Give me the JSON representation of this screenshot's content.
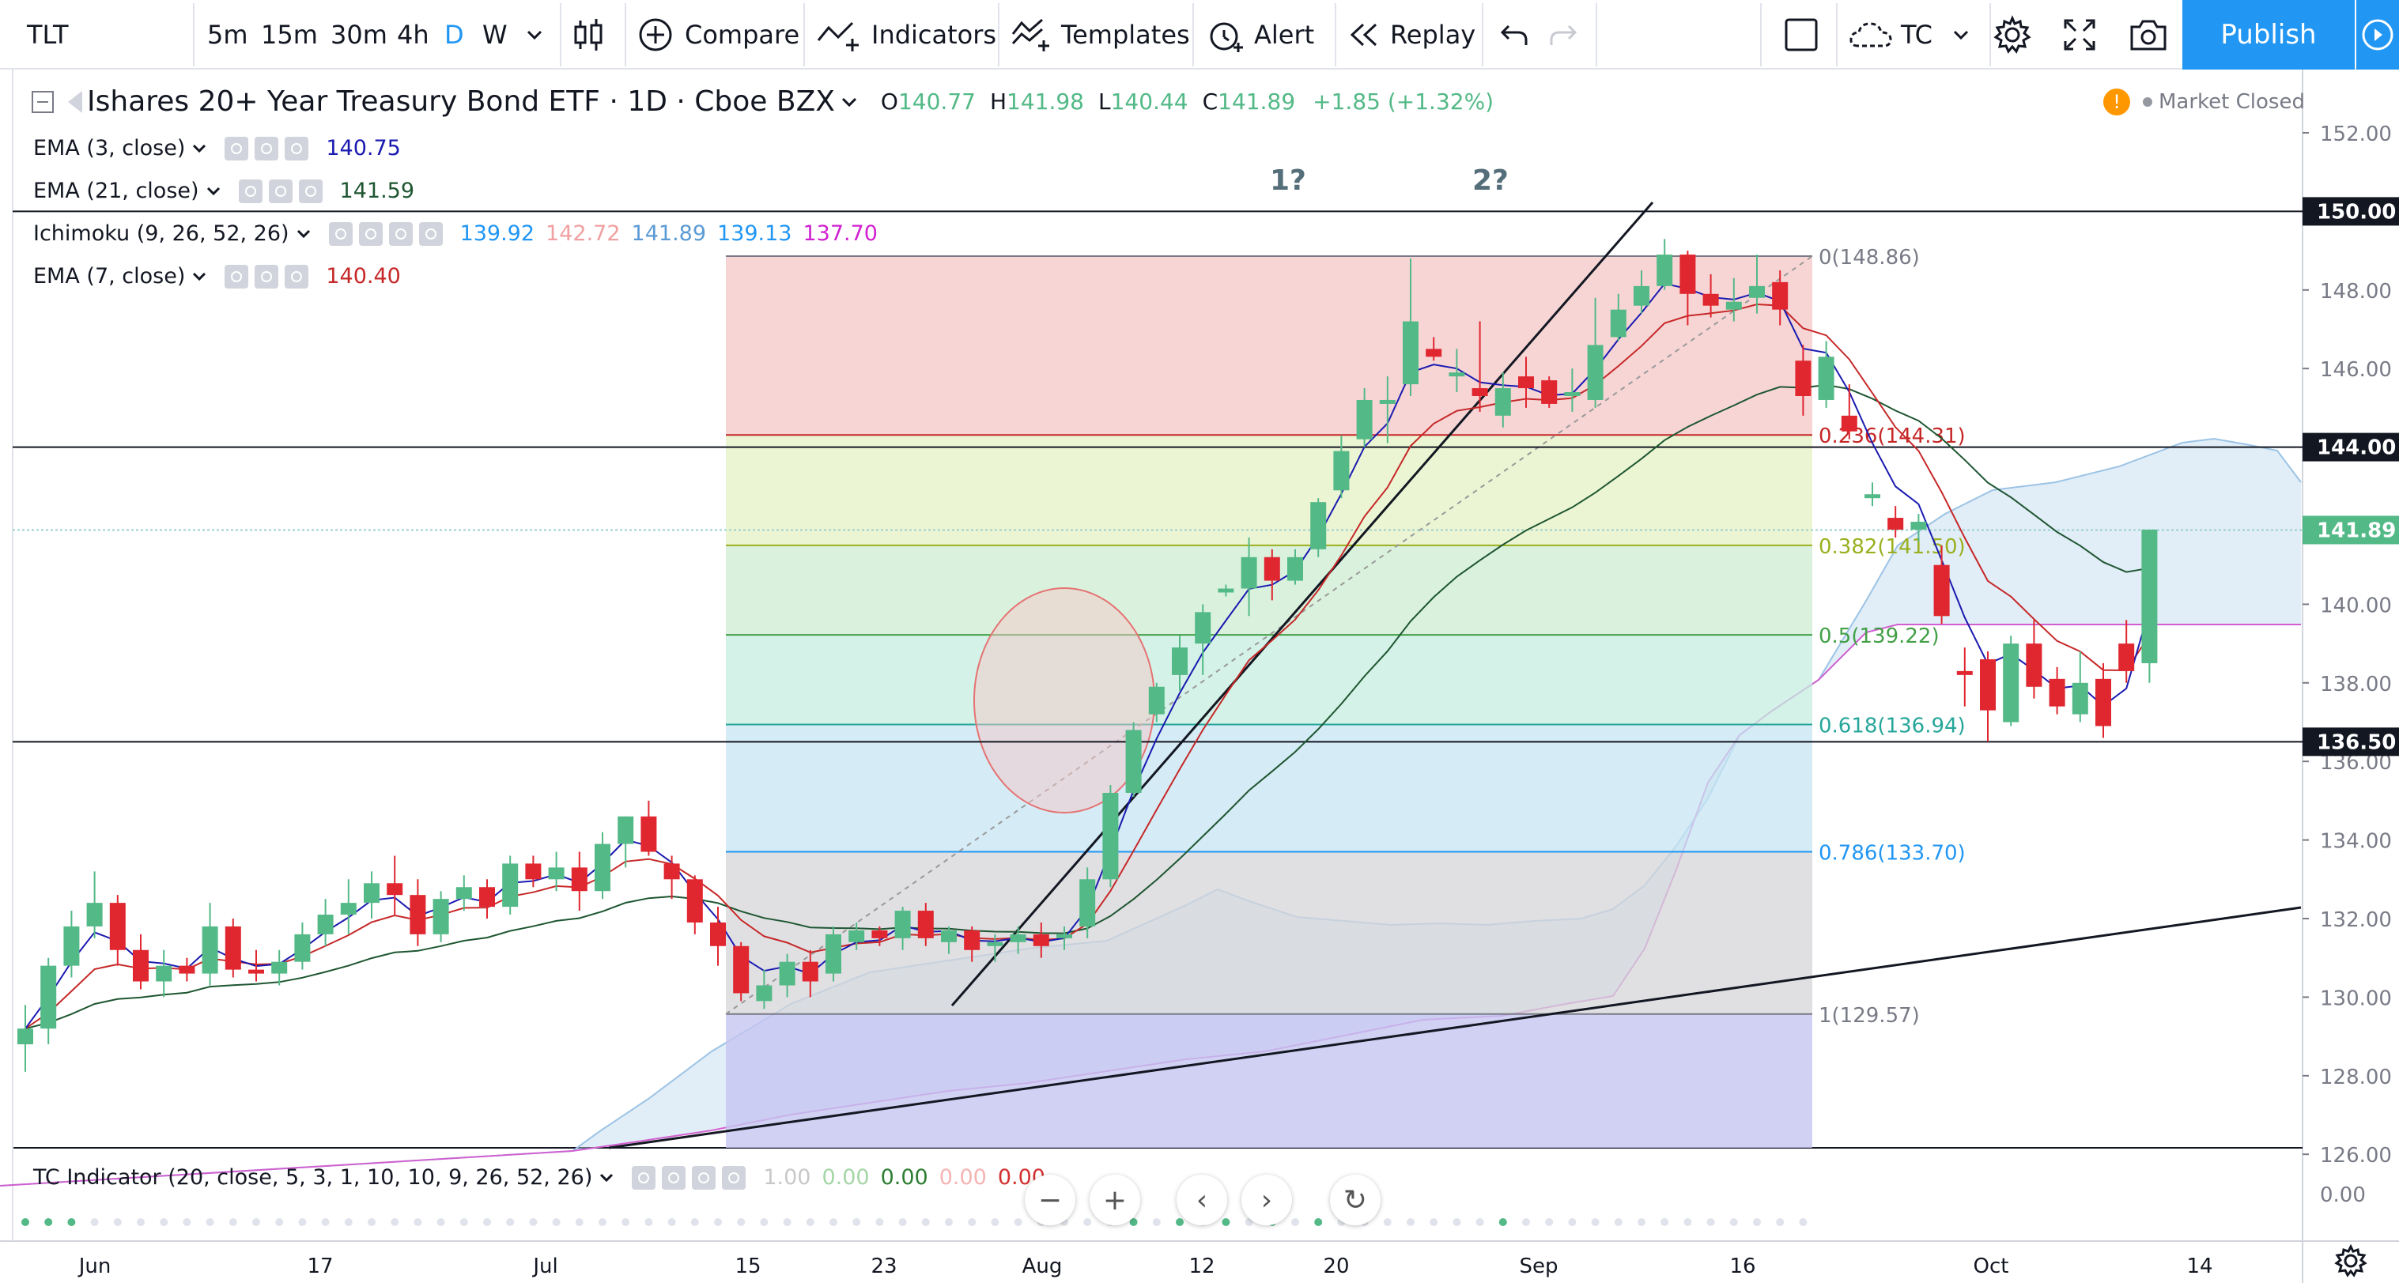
{
  "toolbar": {
    "symbol": "TLT",
    "intervals": [
      "5m",
      "15m",
      "30m",
      "4h",
      "D",
      "W"
    ],
    "active_interval": "D",
    "compare_label": "Compare",
    "indicators_label": "Indicators",
    "templates_label": "Templates",
    "alert_label": "Alert",
    "replay_label": "Replay",
    "layout_name": "TC",
    "publish_label": "Publish"
  },
  "header": {
    "title": "Ishares 20+ Year Treasury Bond ETF · 1D · Cboe BZX",
    "ohlc": {
      "o_label": "O",
      "o": "140.77",
      "h_label": "H",
      "h": "141.98",
      "l_label": "L",
      "l": "140.44",
      "c_label": "C",
      "c": "141.89",
      "change": "+1.85 (+1.32%)"
    },
    "market_status": "Market Closed"
  },
  "legend": [
    {
      "name": "EMA (3, close)",
      "values": [
        {
          "text": "140.75",
          "color": "#1a1ab0"
        }
      ]
    },
    {
      "name": "EMA (21, close)",
      "values": [
        {
          "text": "141.59",
          "color": "#1e5631"
        }
      ]
    },
    {
      "name": "Ichimoku (9, 26, 52, 26)",
      "values": [
        {
          "text": "139.92",
          "color": "#2196f3"
        },
        {
          "text": "142.72",
          "color": "#f0a0a0"
        },
        {
          "text": "141.89",
          "color": "#5b9bd5"
        },
        {
          "text": "139.13",
          "color": "#2196f3"
        },
        {
          "text": "137.70",
          "color": "#d020d0"
        }
      ]
    },
    {
      "name": "EMA (7, close)",
      "values": [
        {
          "text": "140.40",
          "color": "#c62828"
        }
      ]
    }
  ],
  "tc_indicator": {
    "name": "TC Indicator (20, close, 5, 3, 1, 10, 10, 9, 26, 52, 26)",
    "values": [
      {
        "text": "1.00",
        "color": "#c8c8c8"
      },
      {
        "text": "0.00",
        "color": "#a5d6a7"
      },
      {
        "text": "0.00",
        "color": "#2e7d32"
      },
      {
        "text": "0.00",
        "color": "#f4b4b4"
      },
      {
        "text": "0.00",
        "color": "#d32f2f"
      }
    ]
  },
  "annotations": {
    "label_1": "1?",
    "label_2": "2?"
  },
  "price_axis": {
    "ticks": [
      "152.00",
      "150.00",
      "148.00",
      "146.00",
      "144.00",
      "142.00",
      "140.00",
      "138.00",
      "136.00",
      "134.00",
      "132.00",
      "130.00",
      "128.00",
      "126.00"
    ],
    "highlighted": [
      "150.00",
      "144.00",
      "136.50"
    ],
    "current_price": "141.89",
    "oscillator_tick": "0.00"
  },
  "time_axis": [
    "Jun",
    "17",
    "Jul",
    "15",
    "23",
    "Aug",
    "12",
    "20",
    "Sep",
    "16",
    "Oct",
    "14"
  ],
  "fib_levels": [
    {
      "label": "0(148.86)",
      "color": "#787b86",
      "price": 148.86
    },
    {
      "label": "0.236(144.31)",
      "color": "#c62828",
      "price": 144.31
    },
    {
      "label": "0.382(141.50)",
      "color": "#9bb01f",
      "price": 141.5
    },
    {
      "label": "0.5(139.22)",
      "color": "#43a047",
      "price": 139.22
    },
    {
      "label": "0.618(136.94)",
      "color": "#26a69a",
      "price": 136.94
    },
    {
      "label": "0.786(133.70)",
      "color": "#2196f3",
      "price": 133.7
    },
    {
      "label": "1(129.57)",
      "color": "#787b86",
      "price": 129.57
    }
  ],
  "colors": {
    "up": "#53b987",
    "down": "#e0262f",
    "accent": "#2196f3"
  },
  "chart_data": {
    "type": "candlestick",
    "symbol": "TLT",
    "candles_ohlc": [
      [
        128.8,
        129.8,
        128.1,
        129.2
      ],
      [
        129.2,
        131.0,
        128.8,
        130.8
      ],
      [
        130.8,
        132.2,
        130.5,
        131.8
      ],
      [
        131.8,
        133.2,
        131.5,
        132.4
      ],
      [
        132.4,
        132.6,
        130.8,
        131.2
      ],
      [
        131.2,
        131.6,
        130.2,
        130.4
      ],
      [
        130.4,
        131.2,
        130.0,
        130.8
      ],
      [
        130.8,
        131.0,
        130.4,
        130.6
      ],
      [
        130.6,
        132.4,
        130.3,
        131.8
      ],
      [
        131.8,
        132.0,
        130.5,
        130.7
      ],
      [
        130.7,
        131.2,
        130.4,
        130.6
      ],
      [
        130.6,
        131.2,
        130.3,
        130.9
      ],
      [
        130.9,
        131.9,
        130.7,
        131.6
      ],
      [
        131.6,
        132.5,
        131.3,
        132.1
      ],
      [
        132.1,
        133.0,
        131.6,
        132.4
      ],
      [
        132.4,
        133.2,
        132.0,
        132.9
      ],
      [
        132.9,
        133.6,
        132.1,
        132.6
      ],
      [
        132.6,
        133.0,
        131.3,
        131.6
      ],
      [
        131.6,
        132.7,
        131.4,
        132.5
      ],
      [
        132.5,
        133.1,
        132.2,
        132.8
      ],
      [
        132.8,
        133.0,
        132.0,
        132.3
      ],
      [
        132.3,
        133.6,
        132.1,
        133.4
      ],
      [
        133.4,
        133.6,
        132.8,
        133.0
      ],
      [
        133.0,
        133.7,
        132.7,
        133.3
      ],
      [
        133.3,
        133.7,
        132.2,
        132.7
      ],
      [
        132.7,
        134.2,
        132.5,
        133.9
      ],
      [
        133.9,
        134.6,
        133.3,
        134.6
      ],
      [
        134.6,
        135.0,
        133.6,
        133.7
      ],
      [
        133.4,
        133.6,
        132.5,
        133.0
      ],
      [
        133.0,
        133.1,
        131.6,
        131.9
      ],
      [
        131.9,
        132.3,
        130.8,
        131.3
      ],
      [
        131.3,
        131.4,
        129.9,
        130.1
      ],
      [
        129.9,
        130.7,
        129.7,
        130.3
      ],
      [
        130.3,
        131.1,
        130.0,
        130.9
      ],
      [
        130.9,
        131.2,
        130.0,
        130.4
      ],
      [
        130.6,
        131.8,
        130.4,
        131.6
      ],
      [
        131.4,
        131.9,
        131.2,
        131.7
      ],
      [
        131.7,
        131.8,
        131.3,
        131.5
      ],
      [
        131.5,
        132.3,
        131.2,
        132.2
      ],
      [
        132.2,
        132.4,
        131.3,
        131.5
      ],
      [
        131.4,
        131.8,
        131.1,
        131.7
      ],
      [
        131.7,
        131.8,
        130.9,
        131.2
      ],
      [
        131.3,
        131.6,
        130.9,
        131.4
      ],
      [
        131.4,
        131.8,
        131.1,
        131.6
      ],
      [
        131.6,
        131.9,
        131.0,
        131.3
      ],
      [
        131.5,
        131.8,
        131.2,
        131.6
      ],
      [
        131.8,
        133.3,
        131.5,
        133.0
      ],
      [
        133.0,
        135.4,
        132.8,
        135.2
      ],
      [
        135.2,
        137.0,
        135.1,
        136.8
      ],
      [
        137.2,
        138.0,
        137.0,
        137.9
      ],
      [
        138.2,
        139.2,
        137.8,
        138.9
      ],
      [
        139.0,
        140.0,
        138.2,
        139.8
      ],
      [
        140.3,
        140.5,
        140.2,
        140.4
      ],
      [
        140.4,
        141.7,
        139.7,
        141.2
      ],
      [
        141.2,
        141.4,
        140.1,
        140.6
      ],
      [
        140.6,
        141.4,
        140.5,
        141.2
      ],
      [
        141.4,
        142.7,
        141.2,
        142.6
      ],
      [
        142.9,
        144.3,
        142.7,
        143.9
      ],
      [
        144.2,
        145.5,
        144.0,
        145.2
      ],
      [
        145.1,
        145.8,
        144.1,
        145.2
      ],
      [
        145.6,
        148.8,
        145.3,
        147.2
      ],
      [
        146.5,
        146.8,
        146.2,
        146.3
      ],
      [
        145.8,
        146.5,
        145.4,
        145.9
      ],
      [
        145.5,
        147.2,
        144.9,
        145.3
      ],
      [
        144.8,
        145.9,
        144.5,
        145.5
      ],
      [
        145.8,
        146.3,
        145.0,
        145.5
      ],
      [
        145.7,
        145.8,
        145.0,
        145.1
      ],
      [
        145.3,
        146.0,
        144.9,
        145.4
      ],
      [
        145.2,
        147.8,
        145.0,
        146.6
      ],
      [
        146.8,
        147.9,
        146.7,
        147.5
      ],
      [
        147.6,
        148.5,
        147.4,
        148.1
      ],
      [
        148.1,
        149.3,
        148.0,
        148.9
      ],
      [
        148.9,
        149.0,
        147.1,
        147.9
      ],
      [
        147.9,
        148.4,
        147.3,
        147.6
      ],
      [
        147.5,
        148.3,
        147.2,
        147.7
      ],
      [
        147.8,
        148.9,
        147.4,
        148.1
      ],
      [
        148.2,
        148.5,
        147.1,
        147.5
      ],
      [
        146.2,
        146.6,
        144.8,
        145.3
      ],
      [
        145.2,
        146.7,
        145.0,
        146.3
      ],
      [
        144.8,
        145.6,
        144.2,
        144.4
      ],
      [
        142.7,
        143.1,
        142.5,
        142.8
      ],
      [
        142.2,
        142.5,
        141.7,
        141.9
      ],
      [
        141.9,
        142.3,
        141.6,
        142.1
      ],
      [
        141.0,
        141.5,
        139.5,
        139.7
      ],
      [
        138.3,
        138.9,
        137.4,
        138.2
      ],
      [
        138.6,
        138.8,
        136.5,
        137.3
      ],
      [
        137.0,
        139.2,
        136.9,
        139.0
      ],
      [
        139.0,
        139.6,
        137.6,
        137.9
      ],
      [
        138.1,
        138.4,
        137.2,
        137.4
      ],
      [
        137.2,
        138.8,
        137.0,
        138.0
      ],
      [
        138.1,
        138.5,
        136.6,
        136.9
      ],
      [
        139.0,
        139.6,
        138.0,
        138.3
      ],
      [
        138.5,
        141.9,
        138.0,
        141.9
      ]
    ],
    "x_ticks": [
      "Jun",
      "17",
      "Jul",
      "15",
      "23",
      "Aug",
      "12",
      "20",
      "Sep",
      "16",
      "Oct",
      "14"
    ],
    "y_ticks": [
      152,
      150,
      148,
      146,
      144,
      142,
      140,
      138,
      136,
      134,
      132,
      130,
      128,
      126
    ],
    "ylim": [
      125.9,
      153.2
    ],
    "horizontal_levels": [
      150.0,
      144.0,
      136.5
    ],
    "current_price": 141.89,
    "fib_retracement": {
      "from": 148.86,
      "to": 129.57,
      "levels": [
        0,
        0.236,
        0.382,
        0.5,
        0.618,
        0.786,
        1
      ]
    },
    "overlays": [
      "EMA (3, close)",
      "EMA (7, close)",
      "EMA (21, close)",
      "Ichimoku (9, 26, 52, 26)"
    ],
    "annotations": [
      "1?",
      "2?"
    ]
  }
}
